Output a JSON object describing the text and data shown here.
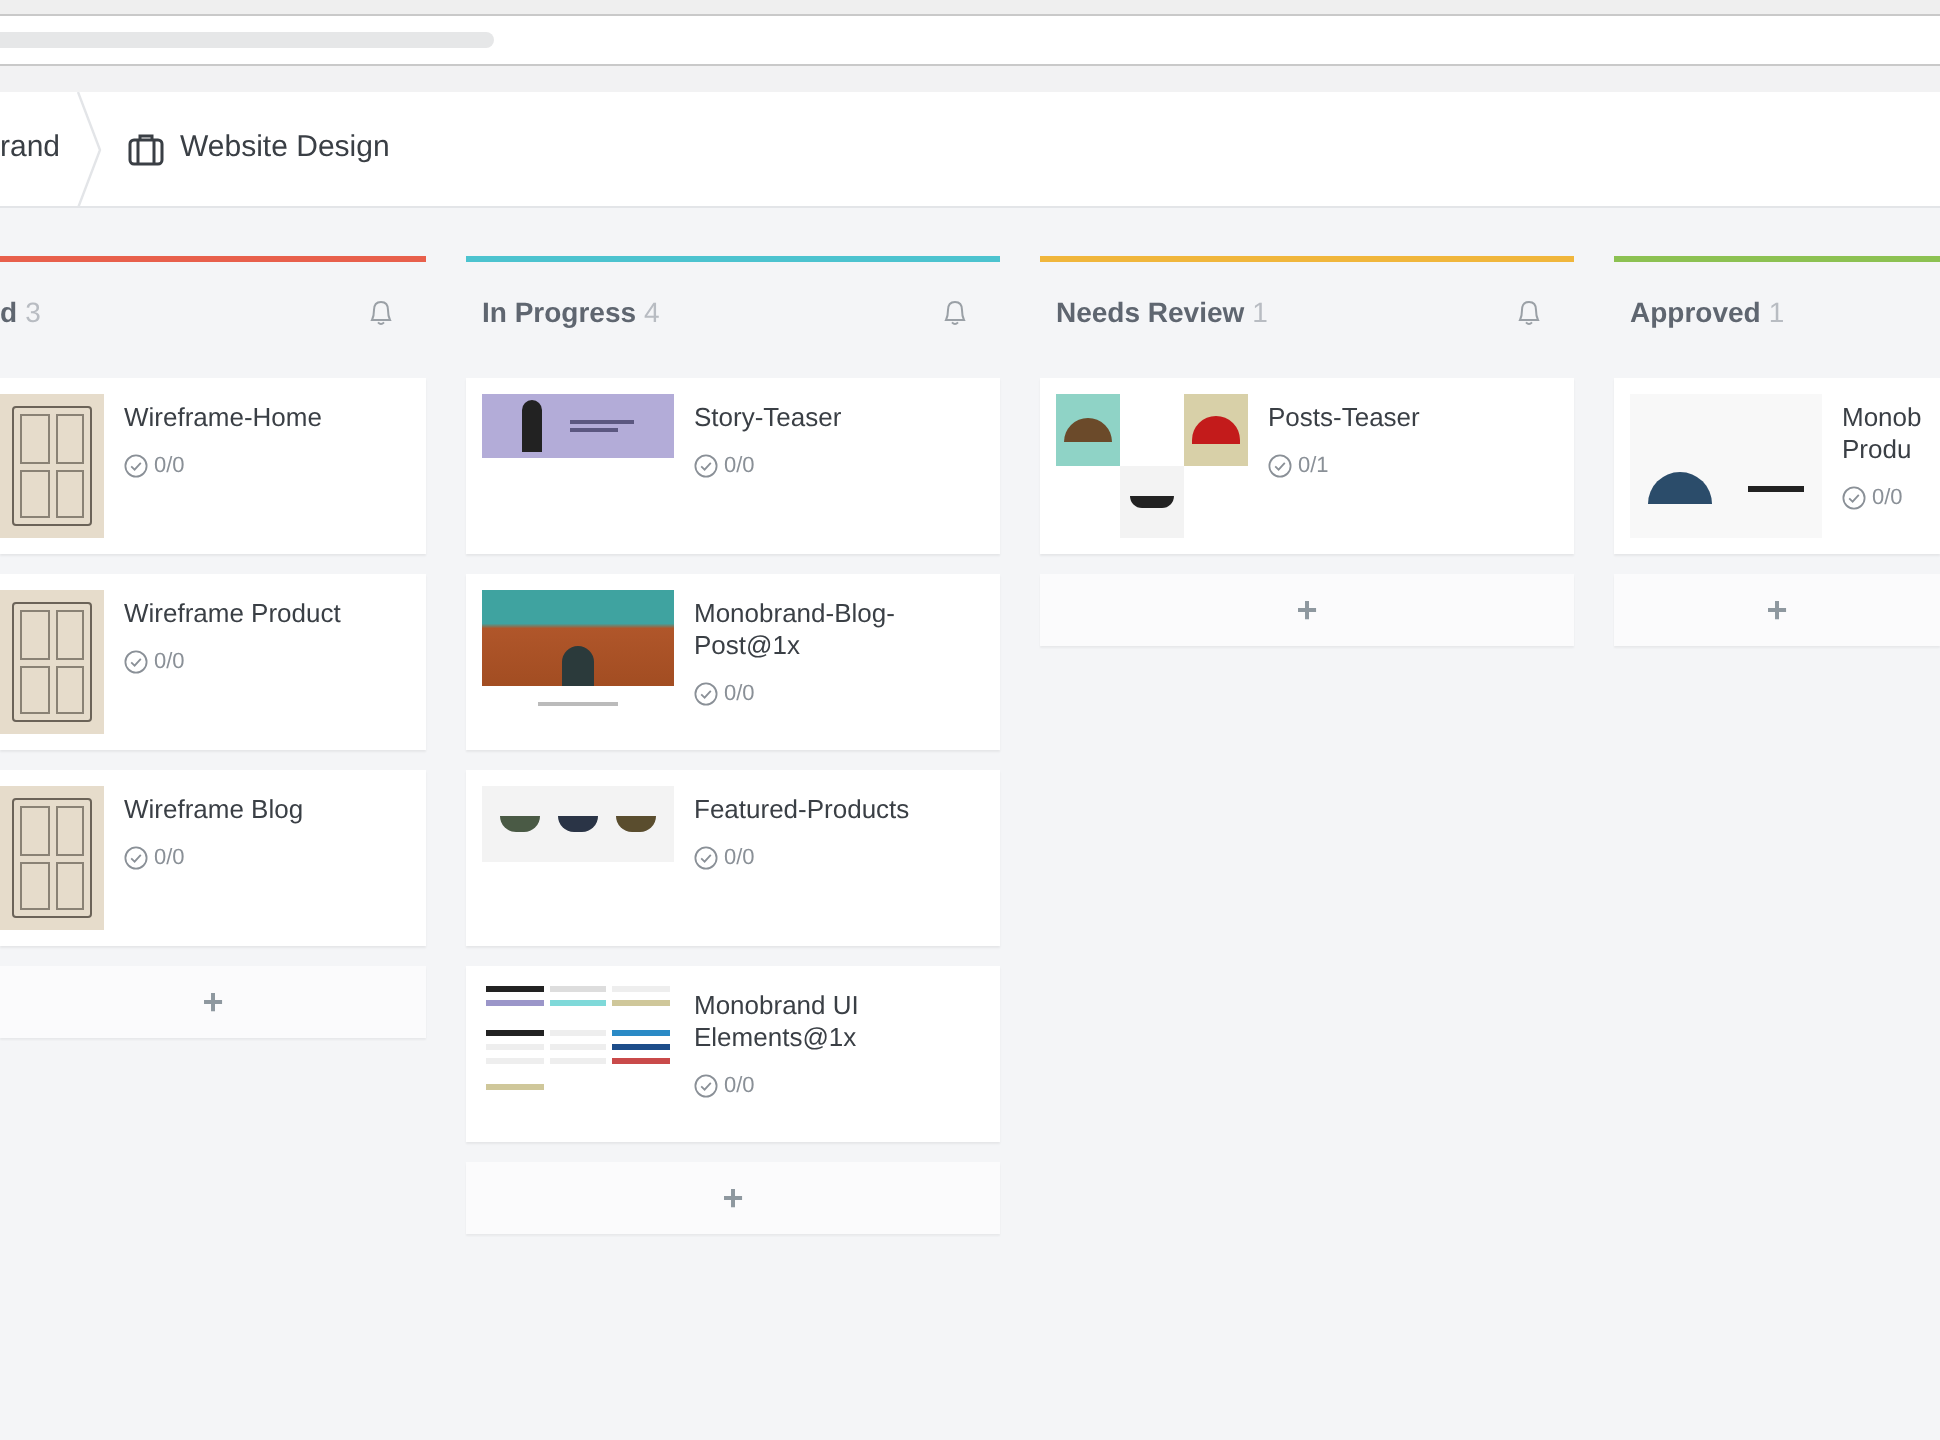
{
  "breadcrumbs": [
    {
      "label": "rand",
      "icon": false
    },
    {
      "label": "Website Design",
      "icon": true
    }
  ],
  "columns": [
    {
      "title": "d",
      "count": "3",
      "color": "#e8604c",
      "bell": true,
      "add_label": "+",
      "cards": [
        {
          "title": "Wireframe-Home",
          "tasks": "0/0",
          "kind": "sketch"
        },
        {
          "title": "Wireframe Product",
          "tasks": "0/0",
          "kind": "sketch"
        },
        {
          "title": "Wireframe Blog",
          "tasks": "0/0",
          "kind": "sketch"
        }
      ]
    },
    {
      "title": "In Progress",
      "count": "4",
      "color": "#4cc3cf",
      "bell": true,
      "add_label": "+",
      "cards": [
        {
          "title": "Story-Teaser",
          "tasks": "0/0",
          "kind": "banner"
        },
        {
          "title": "Monobrand-Blog-Post@1x",
          "tasks": "0/0",
          "kind": "photo"
        },
        {
          "title": "Featured-Products",
          "tasks": "0/0",
          "kind": "products"
        },
        {
          "title": "Monobrand UI Elements@1x",
          "tasks": "0/0",
          "kind": "uikit"
        }
      ]
    },
    {
      "title": "Needs Review",
      "count": "1",
      "color": "#f0b63c",
      "bell": true,
      "add_label": "+",
      "cards": [
        {
          "title": "Posts-Teaser",
          "tasks": "0/1",
          "kind": "collage"
        }
      ]
    },
    {
      "title": "Approved",
      "count": "1",
      "color": "#8cc152",
      "bell": false,
      "add_label": "+",
      "cards": [
        {
          "title": "Monob Produ",
          "tasks": "0/0",
          "kind": "product"
        }
      ]
    }
  ]
}
